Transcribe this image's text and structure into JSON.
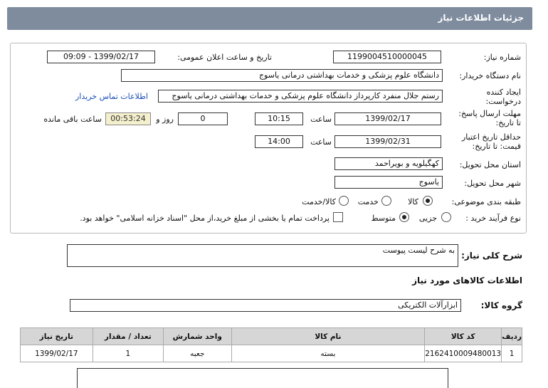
{
  "header": {
    "title": "جزئیات اطلاعات نیاز"
  },
  "form": {
    "need_number_label": "شماره نیاز:",
    "need_number": "1199004510000045",
    "announce_label": "تاریخ و ساعت اعلان عمومی:",
    "announce_value": "1399/02/17 - 09:09",
    "buyer_label": "نام دستگاه خریدار:",
    "buyer_value": "دانشگاه علوم پزشکی و خدمات بهداشتی درمانی یاسوج",
    "creator_label_1": "ایجاد کننده",
    "creator_label_2": "درخواست:",
    "creator_value": "رستم جلال منفرد کارپرداز دانشگاه علوم پزشکی و خدمات بهداشتی درمانی یاسوج",
    "contact_link": "اطلاعات تماس خریدار",
    "deadline_label_1": "مهلت ارسال پاسخ:",
    "deadline_label_2": "تا تاریخ:",
    "deadline_date": "1399/02/17",
    "time_label": "ساعت",
    "deadline_time": "10:15",
    "days_value": "0",
    "days_label": "روز و",
    "remaining_time": "00:53:24",
    "remaining_label": "ساعت باقی مانده",
    "validity_label_1": "حداقل تاریخ اعتبار",
    "validity_label_2": "قیمت: تا تاریخ:",
    "validity_date": "1399/02/31",
    "validity_time": "14:00",
    "province_label": "استان محل تحویل:",
    "province_value": "کهگیلویه و بویراحمد",
    "city_label": "شهر محل تحویل:",
    "city_value": "یاسوج",
    "category_label": "طبقه بندی موضوعی:",
    "category_options": [
      "کالا",
      "خدمت",
      "کالا/خدمت"
    ],
    "process_label": "نوع فرآیند خرید :",
    "process_options": [
      "جزیی",
      "متوسط"
    ],
    "payment_note": "پرداخت تمام یا بخشی از مبلغ خرید،از محل \"اسناد خزانه اسلامی\" خواهد بود."
  },
  "summary": {
    "label": "شرح کلی نیاز:",
    "value": "به شرح لیست پیوست"
  },
  "goods": {
    "section_label": "اطلاعات کالاهای مورد نیاز",
    "group_label": "گروه کالا:",
    "group_value": "ابزارآلات الکتریکی",
    "columns": [
      "ردیف",
      "کد کالا",
      "نام کالا",
      "واحد شمارش",
      "تعداد / مقدار",
      "تاریخ نیاز"
    ],
    "rows": [
      [
        "1",
        "2162410009480013",
        "بسته",
        "جعبه",
        "1",
        "1399/02/17"
      ]
    ]
  }
}
